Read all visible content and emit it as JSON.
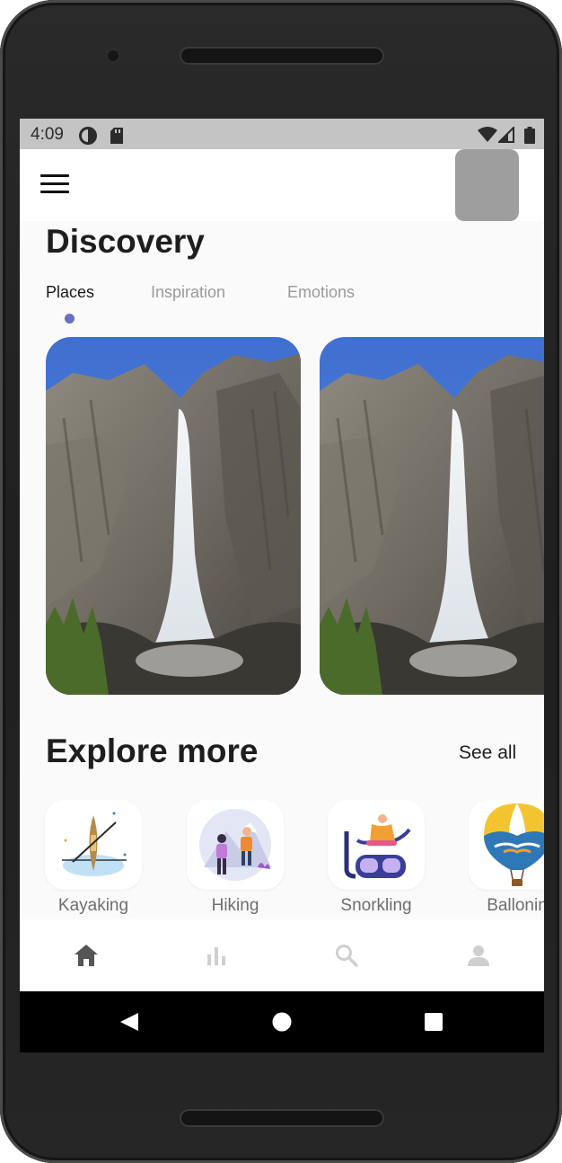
{
  "status_bar": {
    "time": "4:09",
    "icons": [
      "data-saver-icon",
      "sd-card-icon",
      "wifi-icon",
      "signal-icon",
      "battery-icon"
    ]
  },
  "app_bar": {
    "menu_icon": "hamburger-menu-icon",
    "avatar_color": "#9e9e9e"
  },
  "page_title": "Discovery",
  "tabs": [
    {
      "label": "Places",
      "active": true
    },
    {
      "label": "Inspiration",
      "active": false
    },
    {
      "label": "Emotions",
      "active": false
    }
  ],
  "accent_color": "#6a6fc0",
  "cards": [
    {
      "image": "waterfall-photo"
    },
    {
      "image": "waterfall-photo"
    }
  ],
  "explore": {
    "title": "Explore more",
    "see_all": "See all",
    "items": [
      {
        "label": "Kayaking",
        "icon": "kayak-illustration"
      },
      {
        "label": "Hiking",
        "icon": "hikers-illustration"
      },
      {
        "label": "Snorkling",
        "icon": "snorkel-illustration"
      },
      {
        "label": "Ballonin",
        "icon": "hot-air-balloon-illustration"
      }
    ]
  },
  "bottom_nav": {
    "items": [
      {
        "icon": "home-icon",
        "active": true
      },
      {
        "icon": "bar-chart-icon",
        "active": false
      },
      {
        "icon": "search-icon",
        "active": false
      },
      {
        "icon": "person-icon",
        "active": false
      }
    ]
  },
  "system_nav": [
    "back-icon",
    "home-circle-icon",
    "recents-icon"
  ]
}
